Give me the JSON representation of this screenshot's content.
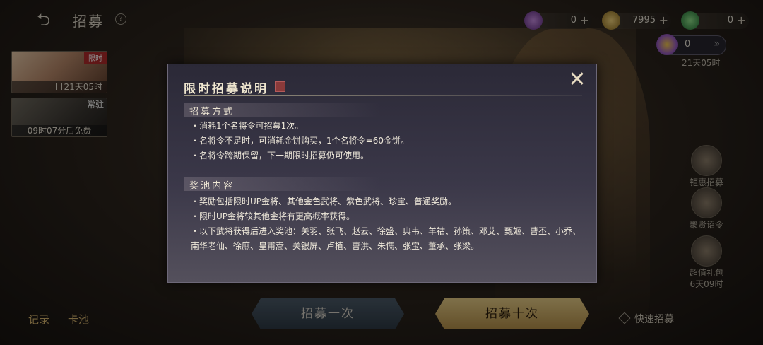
{
  "header": {
    "back_icon": "back-arrow-icon",
    "title": "招募",
    "help": "?"
  },
  "currencies": [
    {
      "icon": "purple-gem-icon",
      "color": "#8a4fb0",
      "value": "0"
    },
    {
      "icon": "gold-coin-icon",
      "color": "#c9a33c",
      "value": "7995"
    },
    {
      "icon": "green-jade-icon",
      "color": "#3fae5a",
      "value": "0"
    }
  ],
  "event": {
    "value": "0",
    "timer": "21天05时"
  },
  "left_cards": [
    {
      "tag": "限时",
      "timer": "21天05时"
    },
    {
      "tag": "常驻",
      "timer": "09时07分后免费"
    }
  ],
  "side_menu": [
    {
      "icon": "gem-bundle-icon",
      "label": "钜惠招募"
    },
    {
      "icon": "scroll-icon",
      "label": "聚贤诏令"
    },
    {
      "icon": "gift-pack-icon",
      "label": "超值礼包",
      "sub": "6天09时"
    }
  ],
  "bottom": {
    "record": "记录",
    "pool": "卡池",
    "recruit_once": "招募一次",
    "recruit_ten": "招募十次",
    "quick": "快速招募"
  },
  "modal": {
    "title": "限时招募说明",
    "sections": [
      {
        "heading": "招募方式",
        "items": [
          "・消耗1个名将令可招募1次。",
          "・名将令不足时，可消耗金饼购买，1个名将令=60金饼。",
          "・名将令跨期保留，下一期限时招募仍可使用。"
        ]
      },
      {
        "heading": "奖池内容",
        "items": [
          "・奖励包括限时UP金将、其他金色武将、紫色武将、珍宝、普通奖励。",
          "・限时UP金将较其他金将有更高概率获得。",
          "・以下武将获得后进入奖池：关羽、张飞、赵云、徐盛、典韦、羊祜、孙策、邓艾、甄姬、曹丕、小乔、南华老仙、徐庶、皇甫嵩、关银屏、卢植、曹洪、朱儁、张宝、董承、张梁。"
        ]
      }
    ]
  }
}
